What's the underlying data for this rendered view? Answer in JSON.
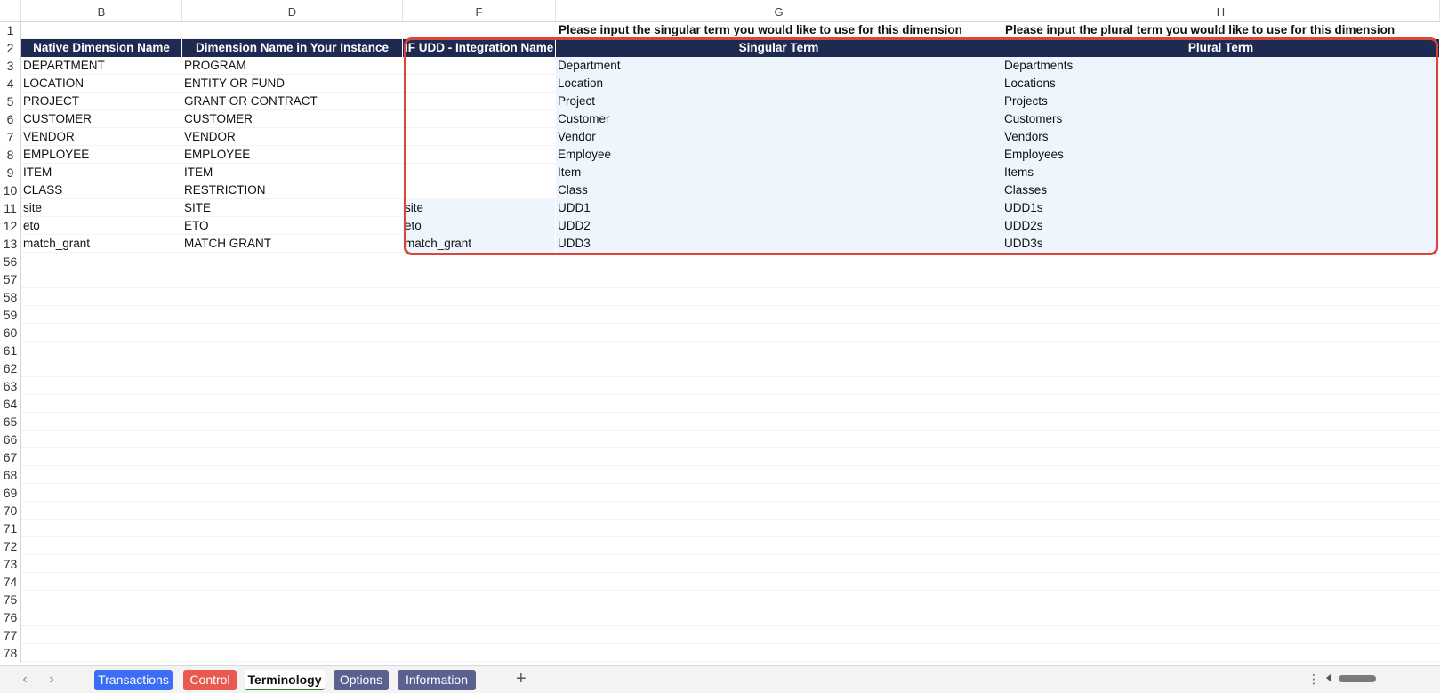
{
  "columns": [
    "B",
    "D",
    "F",
    "G",
    "H"
  ],
  "row_numbers": [
    "1",
    "2",
    "3",
    "4",
    "5",
    "6",
    "7",
    "8",
    "9",
    "10",
    "11",
    "12",
    "13",
    "56",
    "57",
    "58",
    "59",
    "60",
    "61",
    "62",
    "63",
    "64",
    "65",
    "66",
    "67",
    "68",
    "69",
    "70",
    "71",
    "72",
    "73",
    "74",
    "75",
    "76",
    "77",
    "78"
  ],
  "instructions": {
    "singular": "Please input the singular term you would like to use for this dimension",
    "plural": "Please input the plural term you would like to use for this dimension"
  },
  "headers": {
    "native": "Native Dimension Name",
    "instance": "Dimension Name in Your Instance",
    "integration": "IF UDD - Integration Name",
    "singular": "Singular Term",
    "plural": "Plural Term"
  },
  "rows": [
    {
      "native": "DEPARTMENT",
      "instance": "PROGRAM",
      "integration": "",
      "singular": "Department",
      "plural": "Departments"
    },
    {
      "native": "LOCATION",
      "instance": "ENTITY OR FUND",
      "integration": "",
      "singular": "Location",
      "plural": "Locations"
    },
    {
      "native": "PROJECT",
      "instance": "GRANT OR CONTRACT",
      "integration": "",
      "singular": "Project",
      "plural": "Projects"
    },
    {
      "native": "CUSTOMER",
      "instance": "CUSTOMER",
      "integration": "",
      "singular": "Customer",
      "plural": "Customers"
    },
    {
      "native": "VENDOR",
      "instance": "VENDOR",
      "integration": "",
      "singular": "Vendor",
      "plural": "Vendors"
    },
    {
      "native": "EMPLOYEE",
      "instance": "EMPLOYEE",
      "integration": "",
      "singular": "Employee",
      "plural": "Employees"
    },
    {
      "native": "ITEM",
      "instance": "ITEM",
      "integration": "",
      "singular": "Item",
      "plural": "Items"
    },
    {
      "native": "CLASS",
      "instance": "RESTRICTION",
      "integration": "",
      "singular": "Class",
      "plural": "Classes"
    },
    {
      "native": "site",
      "instance": "SITE",
      "integration": "site",
      "singular": "UDD1",
      "plural": "UDD1s"
    },
    {
      "native": "eto",
      "instance": "ETO",
      "integration": "eto",
      "singular": "UDD2",
      "plural": "UDD2s"
    },
    {
      "native": "match_grant",
      "instance": "MATCH GRANT",
      "integration": "match_grant",
      "singular": "UDD3",
      "plural": "UDD3s"
    }
  ],
  "tabs": [
    {
      "label": "Transactions",
      "color": "#3b6ef5",
      "active": false
    },
    {
      "label": "Control",
      "color": "#e85a4f",
      "active": false
    },
    {
      "label": "Terminology",
      "color": "#ffffff",
      "active": true
    },
    {
      "label": "Options",
      "color": "#5a6190",
      "active": false
    },
    {
      "label": "Information",
      "color": "#5a6190",
      "active": false
    }
  ],
  "colors": {
    "header_bg": "#1f2a52",
    "highlight_border": "#d9463a",
    "input_cell_bg": "#eef5fc"
  },
  "icons": {
    "nav_prev": "chevron-left-icon",
    "nav_next": "chevron-right-icon",
    "add_sheet": "plus-icon",
    "more": "vertical-dots-icon"
  }
}
